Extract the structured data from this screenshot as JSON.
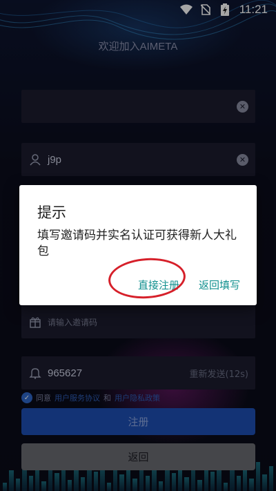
{
  "status_bar": {
    "time": "11:21",
    "icons": [
      "wifi-icon",
      "no-sim-icon",
      "battery-charging-icon"
    ]
  },
  "welcome_text": "欢迎加入AIMETA",
  "form": {
    "phone": {
      "value": "",
      "icon": "phone-icon"
    },
    "username": {
      "value": "j9p",
      "icon": "user-icon"
    },
    "invite_code": {
      "placeholder": "请输入邀请码",
      "icon": "gift-icon"
    },
    "sms_code": {
      "value": "965627",
      "icon": "bell-icon",
      "resend_label": "重新发送(12s)"
    },
    "agreement": {
      "prefix": "同意",
      "user_agreement": "用户服务协议",
      "and": "和",
      "privacy_policy": "用户隐私政策",
      "checked": true
    },
    "register_label": "注册",
    "back_label": "返回"
  },
  "dialog": {
    "title": "提示",
    "message": "填写邀请码并实名认证可获得新人大礼包",
    "buttons": {
      "direct_register": "直接注册",
      "back_fill": "返回填写"
    }
  },
  "colors": {
    "primary_button": "#1e4fb4",
    "dialog_action": "#0f8f8e",
    "annotation": "#d6202a"
  }
}
